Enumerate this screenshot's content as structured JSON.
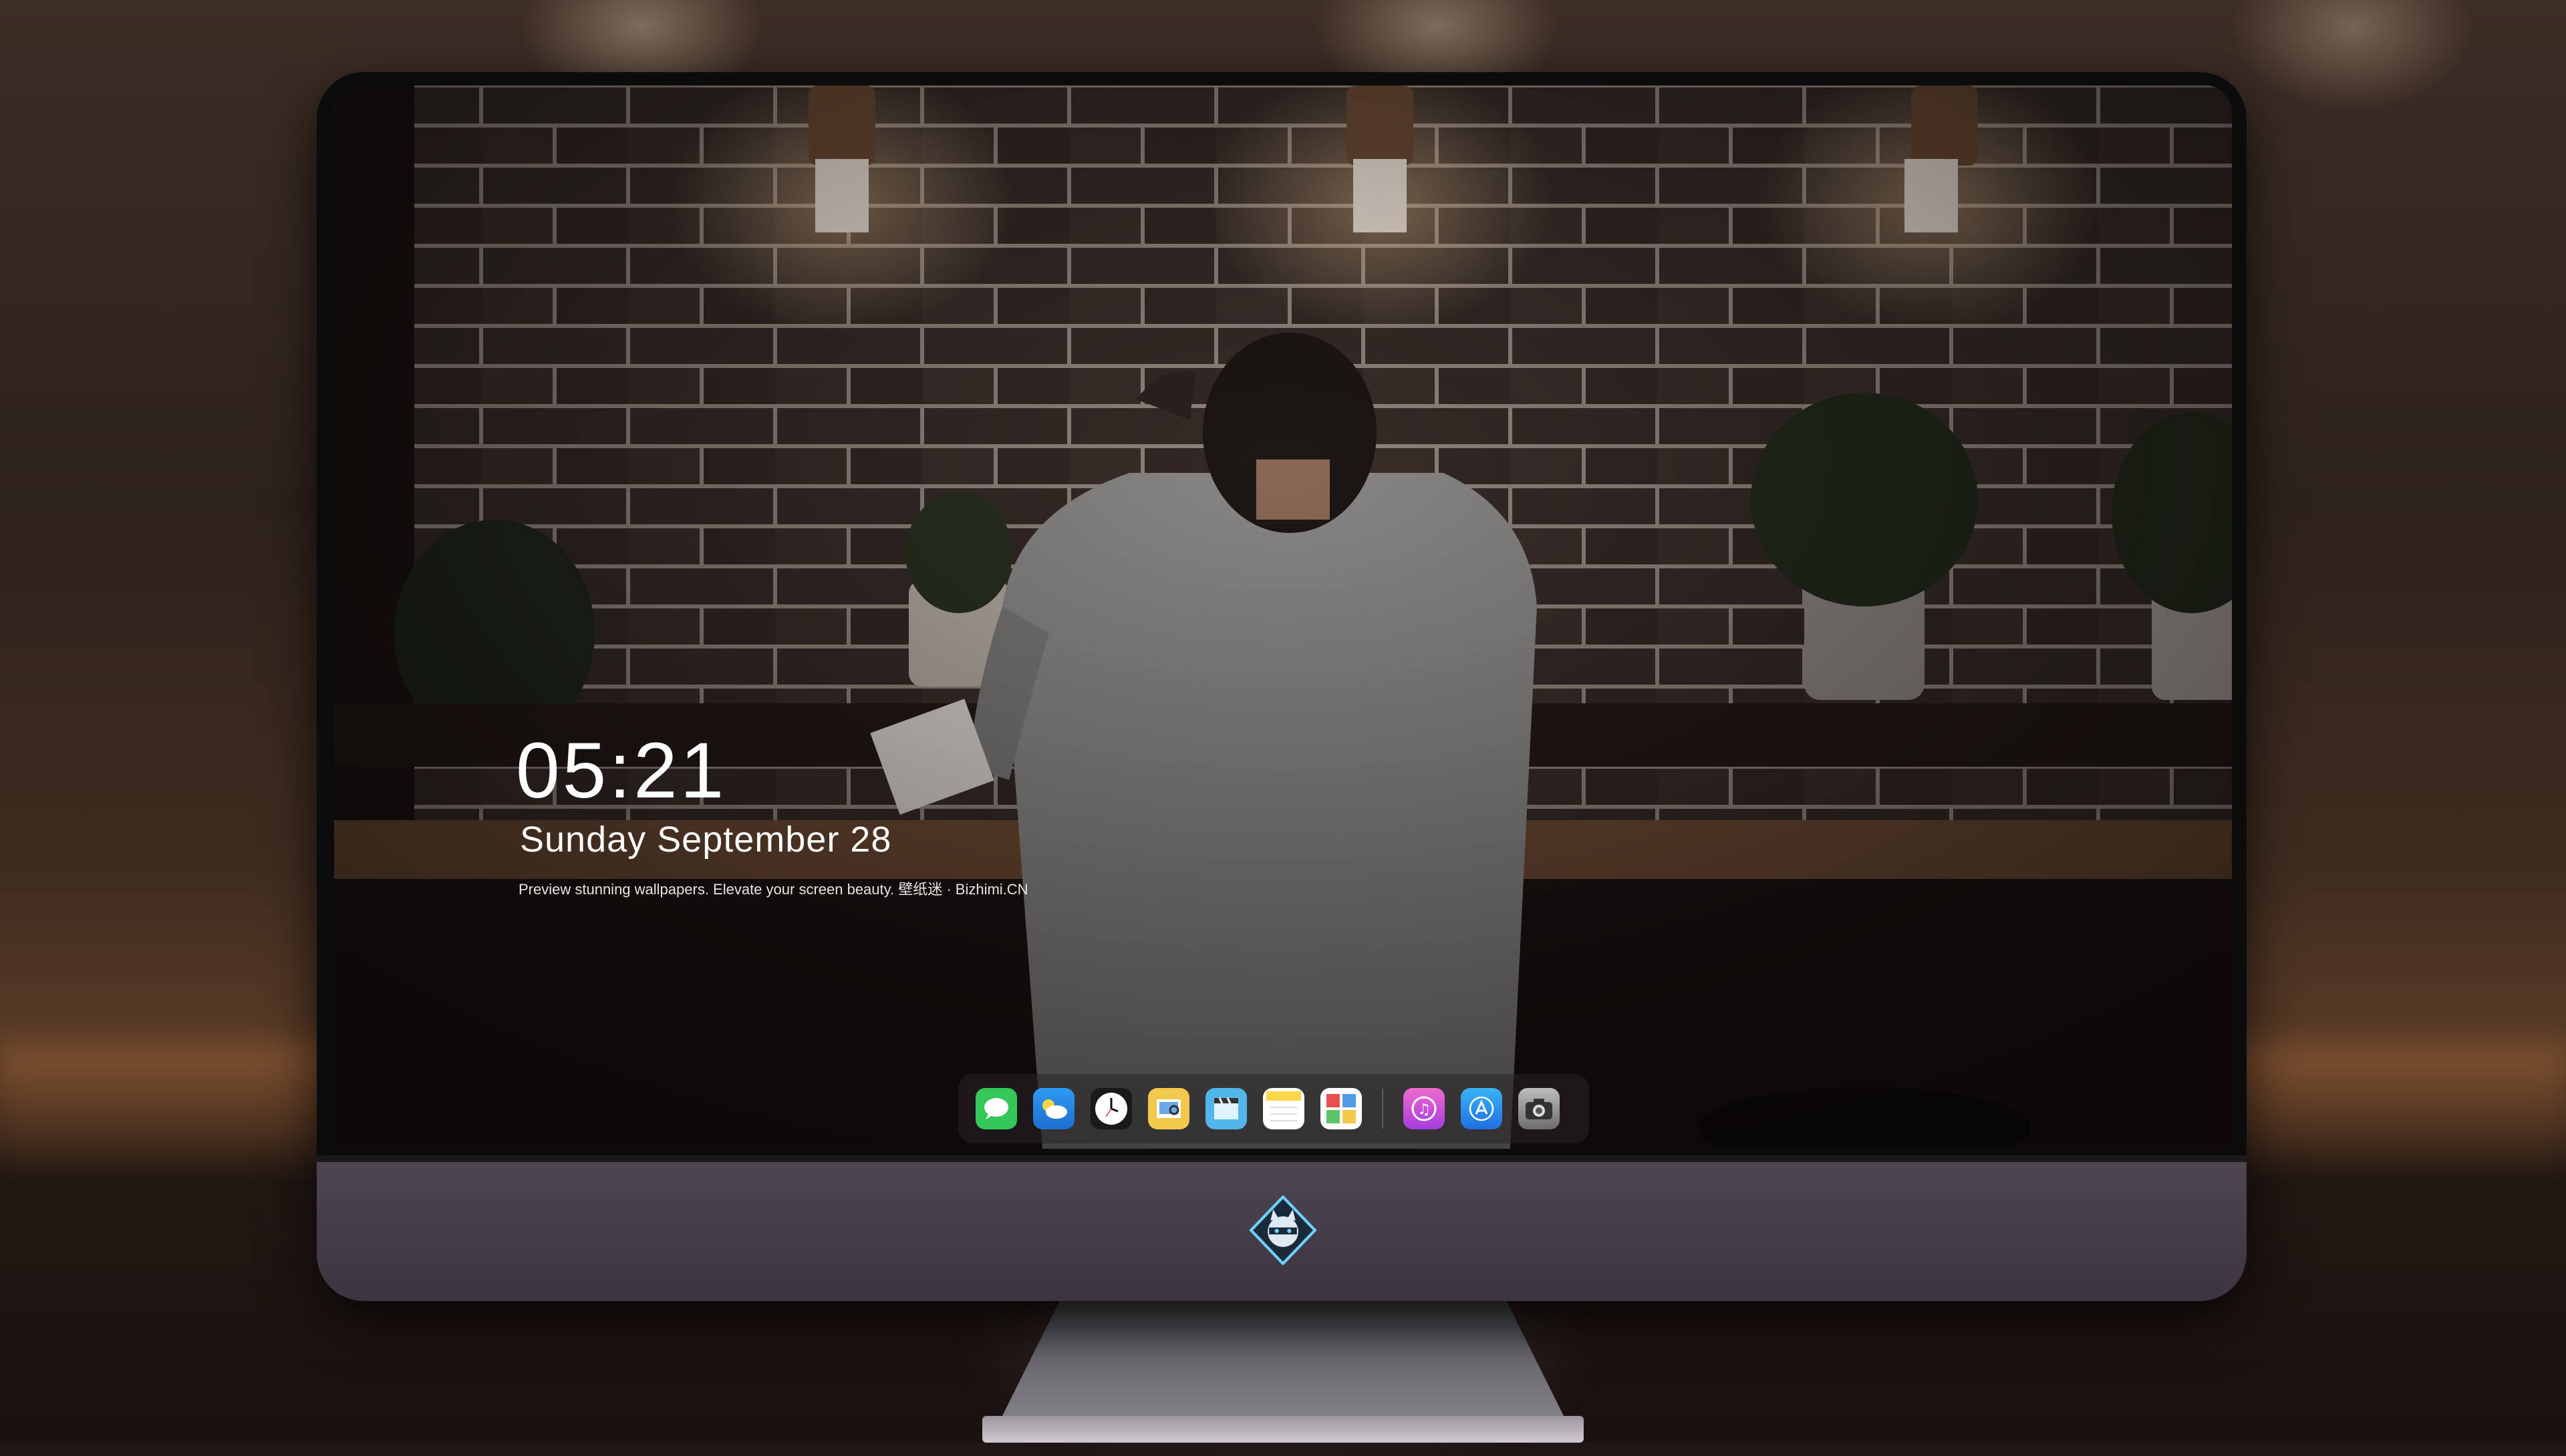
{
  "lockscreen": {
    "time": "05:21",
    "date": "Sunday September  28",
    "tagline": "Preview stunning wallpapers. Elevate your screen beauty. 壁纸迷 · Bizhimi.CN"
  },
  "dock": {
    "icons": [
      {
        "name": "messages-icon",
        "color": "#34c759"
      },
      {
        "name": "weather-icon",
        "color": "#2f9bf2"
      },
      {
        "name": "clock-icon",
        "color": "#ffffff"
      },
      {
        "name": "preview-icon",
        "color": "#f2c94c"
      },
      {
        "name": "clips-icon",
        "color": "#52b7e8"
      },
      {
        "name": "notes-icon",
        "color": "#ffd54a"
      },
      {
        "name": "photo-booth-icon",
        "color": "#5cc36a"
      },
      {
        "name": "itunes-icon",
        "color": "#d24bd8"
      },
      {
        "name": "app-store-icon",
        "color": "#1f8ef1"
      },
      {
        "name": "camera-icon",
        "color": "#888888"
      }
    ]
  },
  "monitor": {
    "logo": "ninja-cat-logo-icon"
  }
}
